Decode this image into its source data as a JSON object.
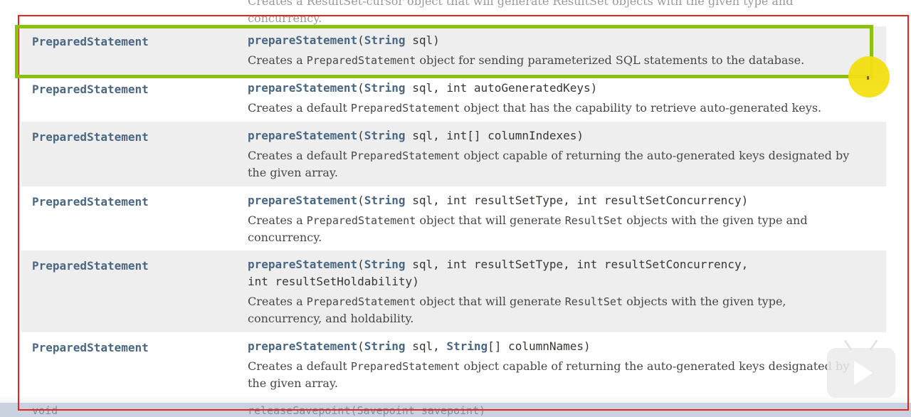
{
  "top_partial": {
    "line1": "Creates a ResultSet-cursor object that will generate ResultSet objects with the given type and",
    "line2": "concurrency."
  },
  "rows": [
    {
      "type": "PreparedStatement",
      "method": "prepareStatement",
      "sig_open": "(",
      "sig_type1": "String",
      "sig_rest1": " sql)",
      "sig_line2": "",
      "desc_parts": [
        "Creates a ",
        "PreparedStatement",
        " object for sending parameterized SQL statements to the database."
      ],
      "desc_line2": ""
    },
    {
      "type": "PreparedStatement",
      "method": "prepareStatement",
      "sig_open": "(",
      "sig_type1": "String",
      "sig_rest1": " sql, int autoGeneratedKeys)",
      "sig_line2": "",
      "desc_parts": [
        "Creates a default ",
        "PreparedStatement",
        " object that has the capability to retrieve auto-generated keys."
      ],
      "desc_line2": ""
    },
    {
      "type": "PreparedStatement",
      "method": "prepareStatement",
      "sig_open": "(",
      "sig_type1": "String",
      "sig_rest1": " sql, int[] columnIndexes)",
      "sig_line2": "",
      "desc_parts": [
        "Creates a default ",
        "PreparedStatement",
        " object capable of returning the auto-generated keys designated by"
      ],
      "desc_line2": "the given array."
    },
    {
      "type": "PreparedStatement",
      "method": "prepareStatement",
      "sig_open": "(",
      "sig_type1": "String",
      "sig_rest1": " sql, int resultSetType, int resultSetConcurrency)",
      "sig_line2": "",
      "desc_parts": [
        "Creates a ",
        "PreparedStatement",
        " object that will generate ",
        "ResultSet",
        " objects with the given type and"
      ],
      "desc_line2": "concurrency."
    },
    {
      "type": "PreparedStatement",
      "method": "prepareStatement",
      "sig_open": "(",
      "sig_type1": "String",
      "sig_rest1": " sql, int resultSetType, int resultSetConcurrency,",
      "sig_line2": "int resultSetHoldability)",
      "desc_parts": [
        "Creates a ",
        "PreparedStatement",
        " object that will generate ",
        "ResultSet",
        " objects with the given type,"
      ],
      "desc_line2": "concurrency, and holdability."
    },
    {
      "type": "PreparedStatement",
      "method": "prepareStatement",
      "sig_open": "(",
      "sig_type1": "String",
      "sig_rest1": " sql, ",
      "sig_type2": "String",
      "sig_rest2": "[] columnNames)",
      "sig_line2": "",
      "desc_parts": [
        "Creates a default ",
        "PreparedStatement",
        " object capable of returning the auto-generated keys designated by"
      ],
      "desc_line2": "the given array."
    }
  ],
  "bottom_row": {
    "type": "void",
    "sig": "releaseSavepoint(Savepoint savepoint)"
  },
  "colors": {
    "annotation_red": "#e8231c",
    "annotation_green": "#8cc10d",
    "cursor_yellow": "#f4e012",
    "link_blue": "#4a6782",
    "row_alt": "#eeeeef"
  },
  "icons": {
    "player": "play-icon"
  }
}
